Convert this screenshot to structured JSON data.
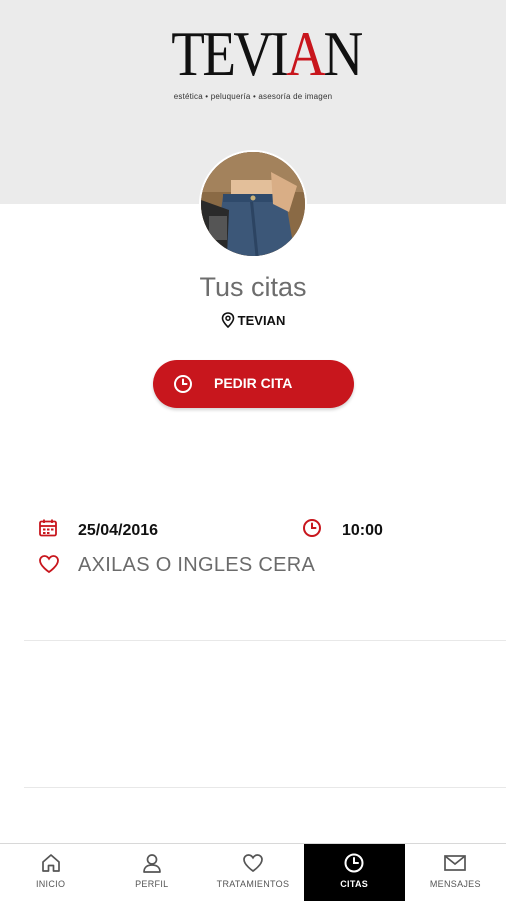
{
  "brand": {
    "name_prefix": "TEVI",
    "name_accent": "A",
    "name_suffix": "N",
    "tagline": "estética • peluquería • asesoría de imagen",
    "accent_color": "#c8161d"
  },
  "header": {
    "title": "Tus citas",
    "location": "TEVIAN",
    "location_icon": "map-pin-icon"
  },
  "actions": {
    "request_label": "PEDIR CITA",
    "request_icon": "clock-icon"
  },
  "appointments": [
    {
      "date": "25/04/2016",
      "time": "10:00",
      "treatment": "AXILAS O INGLES CERA",
      "date_icon": "calendar-icon",
      "time_icon": "clock-icon",
      "treatment_icon": "heart-icon"
    }
  ],
  "nav": {
    "items": [
      {
        "label": "INICIO",
        "icon": "home-icon",
        "active": false
      },
      {
        "label": "PERFIL",
        "icon": "user-icon",
        "active": false
      },
      {
        "label": "TRATAMIENTOS",
        "icon": "heart-icon",
        "active": false
      },
      {
        "label": "CITAS",
        "icon": "clock-icon",
        "active": true
      },
      {
        "label": "MENSAJES",
        "icon": "mail-icon",
        "active": false
      }
    ]
  }
}
